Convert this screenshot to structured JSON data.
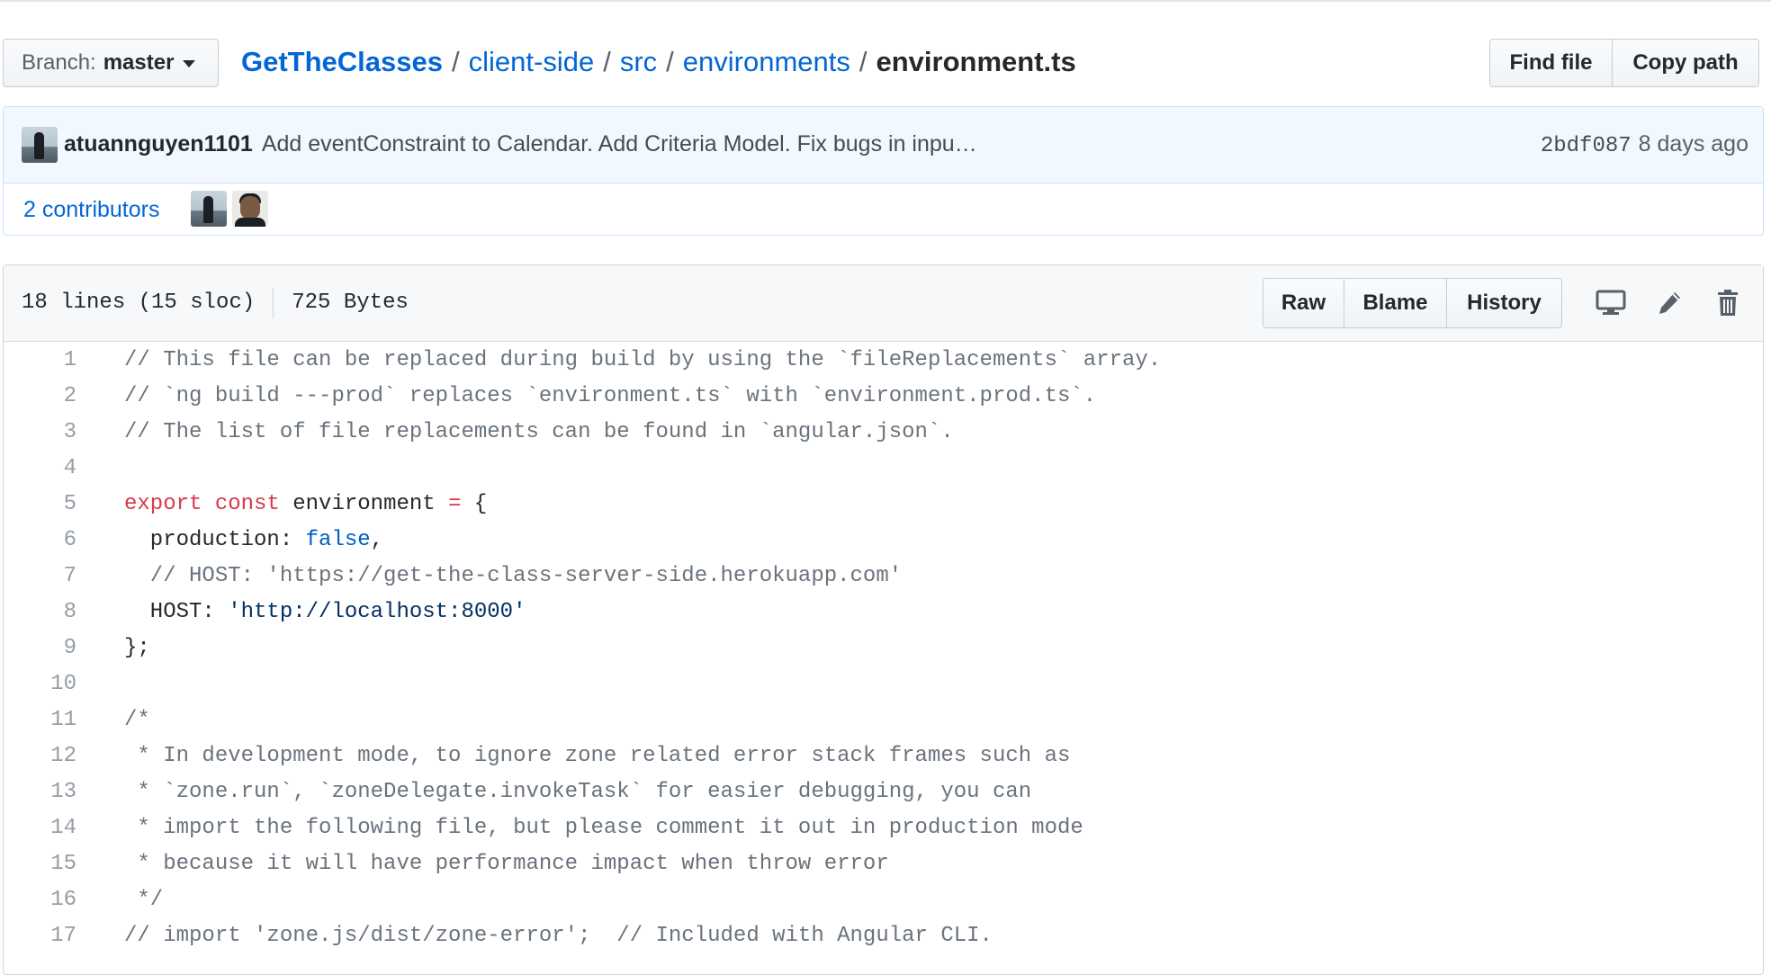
{
  "branch": {
    "label": "Branch:",
    "name": "master"
  },
  "breadcrumb": {
    "repo": "GetTheClasses",
    "segments": [
      "client-side",
      "src",
      "environments"
    ],
    "separator": "/",
    "file": "environment.ts"
  },
  "file_nav": {
    "find_file": "Find file",
    "copy_path": "Copy path"
  },
  "commit": {
    "author": "atuannguyen1101",
    "message": "Add eventConstraint to Calendar. Add Criteria Model. Fix bugs in inpu…",
    "sha": "2bdf087",
    "time": "8 days ago"
  },
  "contributors": {
    "count": "2",
    "label": "contributors"
  },
  "file_header": {
    "lines": "18 lines (15 sloc)",
    "size": "725 Bytes",
    "raw": "Raw",
    "blame": "Blame",
    "history": "History"
  },
  "icons": [
    "desktop-icon",
    "pencil-icon",
    "trash-icon"
  ],
  "code_lines": [
    {
      "n": "1",
      "parts": [
        {
          "t": "// This file can be replaced during build by using the `fileReplacements` array.",
          "c": "c"
        }
      ]
    },
    {
      "n": "2",
      "parts": [
        {
          "t": "// `ng build ---prod` replaces `environment.ts` with `environment.prod.ts`.",
          "c": "c"
        }
      ]
    },
    {
      "n": "3",
      "parts": [
        {
          "t": "// The list of file replacements can be found in `angular.json`.",
          "c": "c"
        }
      ]
    },
    {
      "n": "4",
      "parts": []
    },
    {
      "n": "5",
      "parts": [
        {
          "t": "export",
          "c": "k"
        },
        {
          "t": " ",
          "c": "v"
        },
        {
          "t": "const",
          "c": "k"
        },
        {
          "t": " environment ",
          "c": "v"
        },
        {
          "t": "=",
          "c": "k"
        },
        {
          "t": " {",
          "c": "v"
        }
      ]
    },
    {
      "n": "6",
      "parts": [
        {
          "t": "  production: ",
          "c": "v"
        },
        {
          "t": "false",
          "c": "n"
        },
        {
          "t": ",",
          "c": "v"
        }
      ]
    },
    {
      "n": "7",
      "parts": [
        {
          "t": "  // HOST: 'https://get-the-class-server-side.herokuapp.com'",
          "c": "c"
        }
      ]
    },
    {
      "n": "8",
      "parts": [
        {
          "t": "  HOST: ",
          "c": "v"
        },
        {
          "t": "'http://localhost:8000'",
          "c": "s"
        }
      ]
    },
    {
      "n": "9",
      "parts": [
        {
          "t": "};",
          "c": "v"
        }
      ]
    },
    {
      "n": "10",
      "parts": []
    },
    {
      "n": "11",
      "parts": [
        {
          "t": "/*",
          "c": "c"
        }
      ]
    },
    {
      "n": "12",
      "parts": [
        {
          "t": " * In development mode, to ignore zone related error stack frames such as",
          "c": "c"
        }
      ]
    },
    {
      "n": "13",
      "parts": [
        {
          "t": " * `zone.run`, `zoneDelegate.invokeTask` for easier debugging, you can",
          "c": "c"
        }
      ]
    },
    {
      "n": "14",
      "parts": [
        {
          "t": " * import the following file, but please comment it out in production mode",
          "c": "c"
        }
      ]
    },
    {
      "n": "15",
      "parts": [
        {
          "t": " * because it will have performance impact when throw error",
          "c": "c"
        }
      ]
    },
    {
      "n": "16",
      "parts": [
        {
          "t": " */",
          "c": "c"
        }
      ]
    },
    {
      "n": "17",
      "parts": [
        {
          "t": "// import 'zone.js/dist/zone-error';  // Included with Angular CLI.",
          "c": "c"
        }
      ]
    }
  ]
}
